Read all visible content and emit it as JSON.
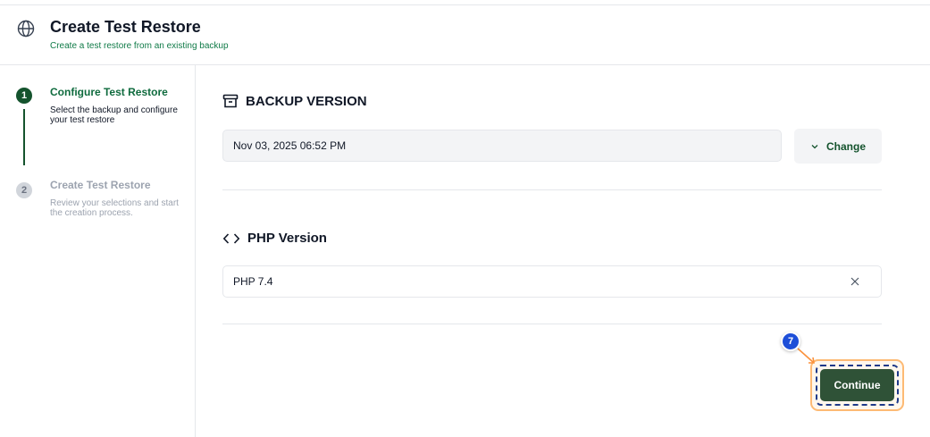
{
  "header": {
    "title": "Create Test Restore",
    "subtitle": "Create a test restore from an existing backup",
    "icon": "globe-icon"
  },
  "steps": [
    {
      "number": "1",
      "title": "Configure Test Restore",
      "description": "Select the backup and configure your test restore",
      "state": "active"
    },
    {
      "number": "2",
      "title": "Create Test Restore",
      "description": "Review your selections and start the creation process.",
      "state": "inactive"
    }
  ],
  "backup": {
    "heading": "BACKUP VERSION",
    "icon": "archive-icon",
    "value": "Nov 03, 2025 06:52 PM",
    "change_label": "Change"
  },
  "php": {
    "heading": "PHP Version",
    "icon": "code-icon",
    "value": "PHP 7.4"
  },
  "actions": {
    "continue_label": "Continue"
  },
  "annotation": {
    "badge": "7"
  },
  "colors": {
    "accent": "#14532d",
    "accent_text": "#0f7a47",
    "continue_bg": "#2f5237",
    "badge": "#1d4ed8",
    "highlight": "#fdba74"
  }
}
